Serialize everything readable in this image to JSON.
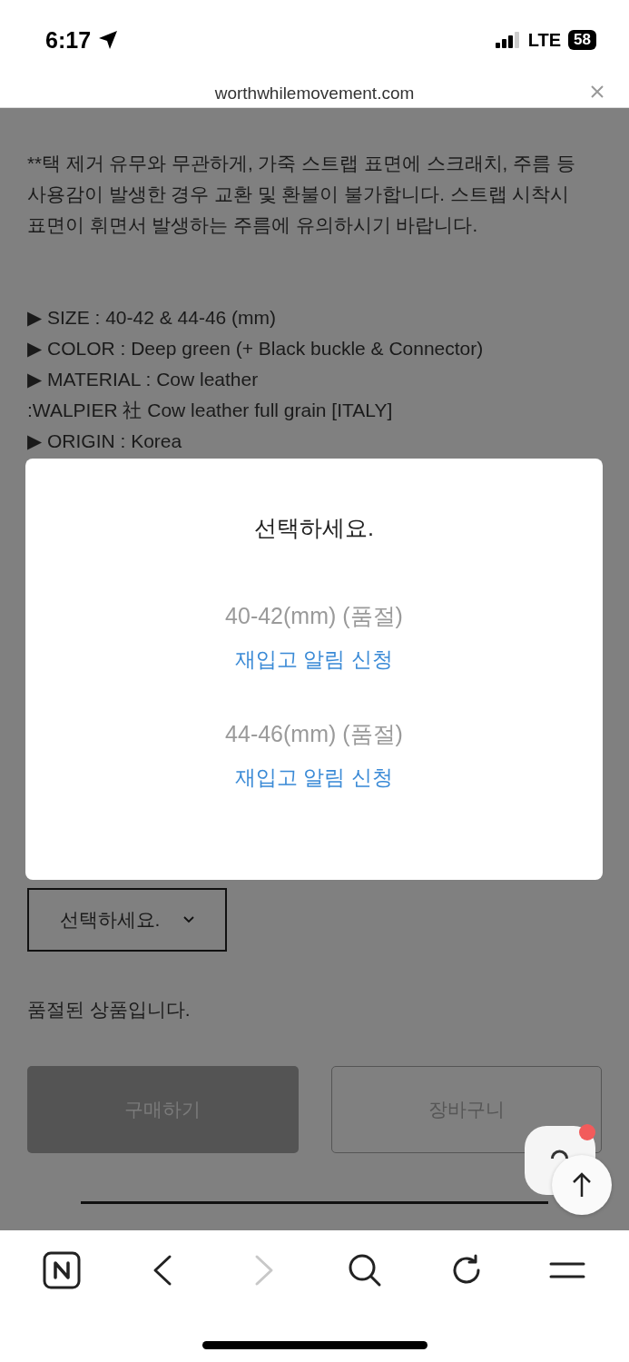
{
  "status_bar": {
    "time": "6:17",
    "network": "LTE",
    "battery": "58"
  },
  "address_bar": {
    "url": "worthwhilemovement.com"
  },
  "notice": "**택 제거 유무와 무관하게, 가죽 스트랩 표면에 스크래치, 주름 등 사용감이 발생한 경우 교환 및 환불이 불가합니다. 스트랩 시착시 표면이 휘면서 발생하는 주름에 유의하시기 바랍니다.",
  "specs": [
    "▶ SIZE : 40-42 & 44-46 (mm)",
    "▶ COLOR : Deep green (+ Black buckle & Connector)",
    "▶ MATERIAL : Cow leather",
    ":WALPIER 社 Cow leather full grain [ITALY]",
    "▶ ORIGIN : Korea"
  ],
  "modal": {
    "title": "선택하세요.",
    "options": [
      {
        "label": "40-42(mm) (품절)",
        "action": "재입고 알림 신청"
      },
      {
        "label": "44-46(mm) (품절)",
        "action": "재입고 알림 신청"
      }
    ]
  },
  "select": {
    "value": "선택하세요."
  },
  "status_text": "품절된 상품입니다.",
  "buttons": [
    {
      "label": "구매하기",
      "kind": "filled"
    },
    {
      "label": "장바구니",
      "kind": "outline"
    }
  ],
  "chat": {
    "unread": true
  },
  "toolbar": [
    {
      "kind": "naver",
      "disabled": false
    },
    {
      "kind": "back",
      "disabled": false
    },
    {
      "kind": "forward",
      "disabled": true
    },
    {
      "kind": "search",
      "disabled": false
    },
    {
      "kind": "reload",
      "disabled": false
    },
    {
      "kind": "menu",
      "disabled": false
    }
  ]
}
